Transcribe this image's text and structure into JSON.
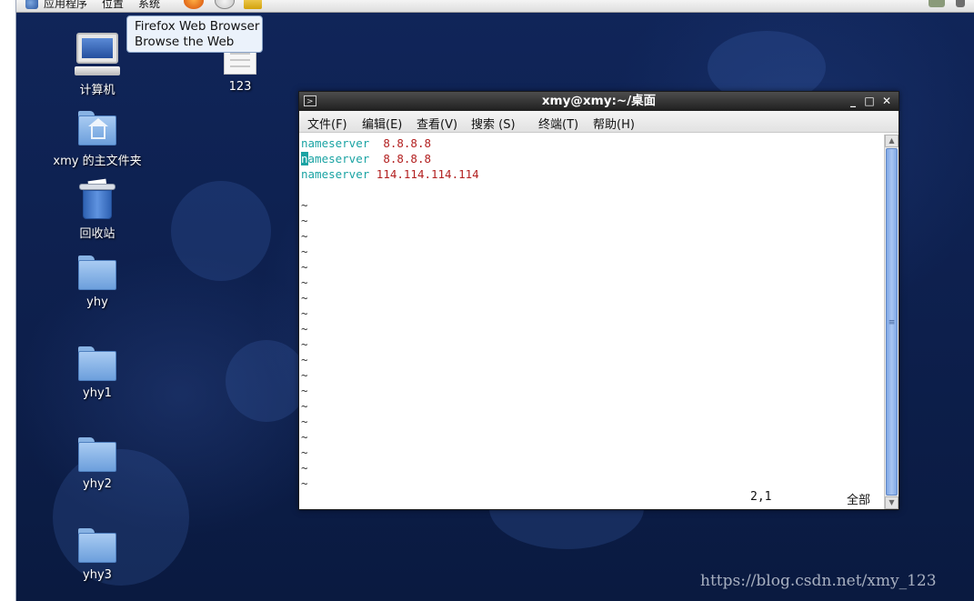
{
  "top_panel": {
    "menus": [
      "应用程序",
      "位置",
      "系统"
    ]
  },
  "tooltip": {
    "line1": "Firefox Web Browser",
    "line2": "Browse the Web"
  },
  "desktop": {
    "icons": [
      {
        "label": "计算机"
      },
      {
        "label": "123"
      },
      {
        "label": "xmy 的主文件夹"
      },
      {
        "label": "回收站"
      },
      {
        "label": "yhy"
      },
      {
        "label": "yhy1"
      },
      {
        "label": "yhy2"
      },
      {
        "label": "yhy3"
      }
    ]
  },
  "terminal": {
    "title": "xmy@xmy:~/桌面",
    "controls": {
      "minimize": "_",
      "maximize": "□",
      "close": "✕"
    },
    "menus": [
      "文件(F)",
      "编辑(E)",
      "查看(V)",
      "搜索 (S)",
      "终端(T)",
      "帮助(H)"
    ],
    "lines": [
      {
        "key": "nameserver",
        "value": "  8.8.8.8"
      },
      {
        "key_first": "n",
        "key_rest": "ameserver",
        "value": "  8.8.8.8"
      },
      {
        "key": "nameserver",
        "value": " 114.114.114.114"
      }
    ],
    "tilde": "~",
    "status_position": "2,1",
    "status_extent": "全部"
  },
  "watermark": "https://blog.csdn.net/xmy_123",
  "colors": {
    "keyword": "#1aa3a3",
    "value": "#b21f1f",
    "titlebar": "#2b2b2b",
    "desktop": "#102559"
  }
}
